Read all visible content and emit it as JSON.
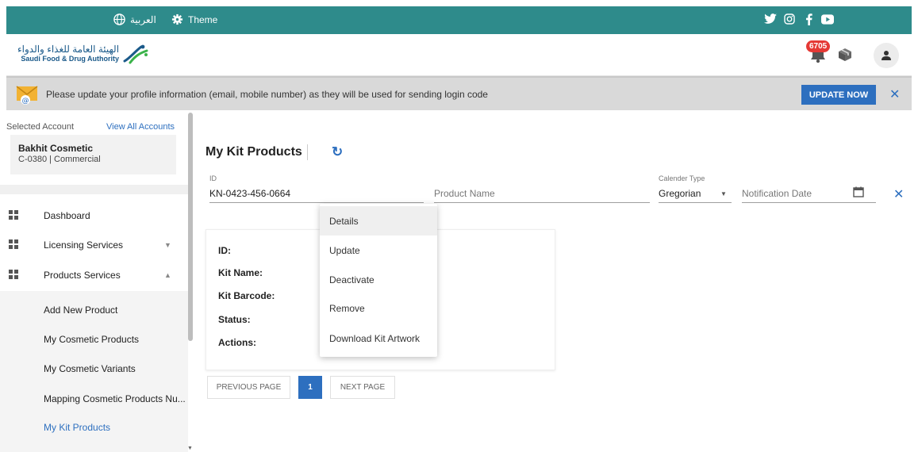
{
  "topbar": {
    "language_label": "العربية",
    "theme_label": "Theme",
    "bg_color": "#2e8b8b",
    "social_icons": [
      "twitter-icon",
      "instagram-icon",
      "facebook-icon",
      "youtube-icon"
    ]
  },
  "header": {
    "logo_ar": "الهيئة العامة للغذاء والدواء",
    "logo_en": "Saudi Food & Drug Authority",
    "notification_count": "6705"
  },
  "banner": {
    "message": "Please update your profile information (email, mobile number) as they will be used for sending login code",
    "update_button": "UPDATE NOW",
    "close_label": "✕"
  },
  "sidebar": {
    "selected_account_label": "Selected Account",
    "view_all_label": "View All Accounts",
    "account_name": "Bakhit Cosmetic",
    "account_code": "C-0380 | Commercial",
    "menu": [
      {
        "label": "Dashboard"
      },
      {
        "label": "Licensing Services"
      },
      {
        "label": "Products Services"
      }
    ],
    "sub_items": [
      {
        "label": "Add New Product"
      },
      {
        "label": "My Cosmetic Products"
      },
      {
        "label": "My Cosmetic Variants"
      },
      {
        "label": "Mapping Cosmetic Products Nu..."
      },
      {
        "label": "My Kit Products"
      }
    ]
  },
  "main": {
    "title": "My Kit Products",
    "filters": {
      "id_label": "ID",
      "id_value": "KN-0423-456-0664",
      "product_name_placeholder": "Product Name",
      "calendar_label": "Calender Type",
      "calendar_value": "Gregorian",
      "notification_date_placeholder": "Notification Date"
    },
    "card_fields": [
      "ID:",
      "Kit Name:",
      "Kit Barcode:",
      "Status:",
      "Actions:"
    ],
    "pagination": {
      "previous": "PREVIOUS PAGE",
      "current_page": "1",
      "next": "NEXT PAGE"
    }
  },
  "dropdown": {
    "items": [
      "Details",
      "Update",
      "Deactivate",
      "Remove",
      "Download Kit Artwork"
    ]
  },
  "colors": {
    "accent": "#2d6fbf",
    "badge": "#e53935"
  }
}
